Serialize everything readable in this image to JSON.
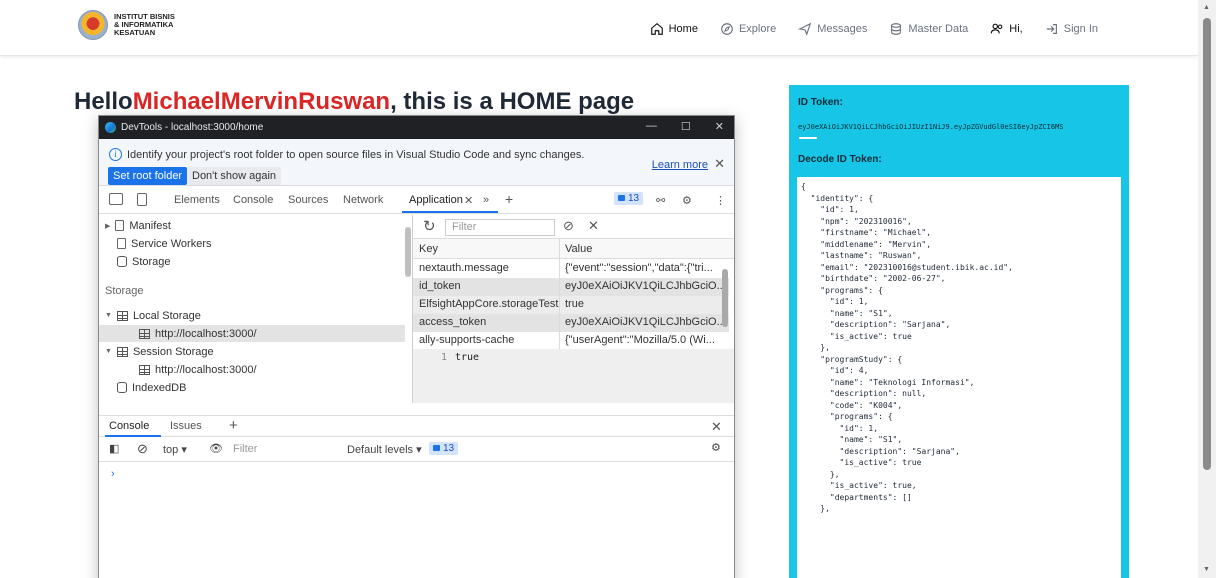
{
  "brand": {
    "logo_line1": "INSTITUT BISNIS",
    "logo_line2": "& INFORMATIKA",
    "logo_line3": "KESATUAN"
  },
  "nav": {
    "home": "Home",
    "explore": "Explore",
    "messages": "Messages",
    "master_data": "Master Data",
    "hi": "Hi,",
    "sign_in": "Sign In"
  },
  "heading": {
    "prefix": "Hello",
    "name": "MichaelMervinRuswan",
    "suffix": ", this is a HOME page"
  },
  "devtools": {
    "title": "DevTools - localhost:3000/home",
    "info_message": "Identify your project's root folder to open source files in Visual Studio Code and sync changes.",
    "learn_more": "Learn more",
    "set_root_folder": "Set root folder",
    "dont_show_again": "Don't show again",
    "tabs": [
      "Elements",
      "Console",
      "Sources",
      "Network",
      "Application"
    ],
    "issues_count": "13",
    "tree": {
      "manifest": "Manifest",
      "service_workers": "Service Workers",
      "storage_item": "Storage",
      "storage_section": "Storage",
      "local_storage": "Local Storage",
      "local_origin": "http://localhost:3000/",
      "session_storage": "Session Storage",
      "session_origin": "http://localhost:3000/",
      "indexeddb": "IndexedDB"
    },
    "filter_placeholder": "Filter",
    "table": {
      "col_key": "Key",
      "col_value": "Value",
      "rows": [
        {
          "key": "nextauth.message",
          "value": "{\"event\":\"session\",\"data\":{\"tri..."
        },
        {
          "key": "id_token",
          "value": "eyJ0eXAiOiJKV1QiLCJhbGciO..."
        },
        {
          "key": "ElfsightAppCore.storageTest",
          "value": "true"
        },
        {
          "key": "access_token",
          "value": "eyJ0eXAiOiJKV1QiLCJhbGciO..."
        },
        {
          "key": "ally-supports-cache",
          "value": "{\"userAgent\":\"Mozilla/5.0 (Wi..."
        }
      ]
    },
    "value_preview_line": "1",
    "value_preview_text": "true",
    "drawer": {
      "console_tab": "Console",
      "issues_tab": "Issues",
      "context": "top",
      "filter_placeholder": "Filter",
      "levels": "Default levels",
      "count": "13",
      "prompt": "›"
    }
  },
  "token_panel": {
    "id_token_label": "ID Token:",
    "id_token_value": "eyJ0eXAiOiJKV1QiLCJhbGciOiJIUzI1NiJ9.eyJpZGVudGl0eSI6eyJpZCI6MS",
    "decode_label": "Decode ID Token:",
    "decoded_json": "{\n  \"identity\": {\n    \"id\": 1,\n    \"npm\": \"202310016\",\n    \"firstname\": \"Michael\",\n    \"middlename\": \"Mervin\",\n    \"lastname\": \"Ruswan\",\n    \"email\": \"202310016@student.ibik.ac.id\",\n    \"birthdate\": \"2002-06-27\",\n    \"programs\": {\n      \"id\": 1,\n      \"name\": \"S1\",\n      \"description\": \"Sarjana\",\n      \"is_active\": true\n    },\n    \"programStudy\": {\n      \"id\": 4,\n      \"name\": \"Teknologi Informasi\",\n      \"description\": null,\n      \"code\": \"K004\",\n      \"programs\": {\n        \"id\": 1,\n        \"name\": \"S1\",\n        \"description\": \"Sarjana\",\n        \"is_active\": true\n      },\n      \"is_active\": true,\n      \"departments\": []\n    },"
  }
}
